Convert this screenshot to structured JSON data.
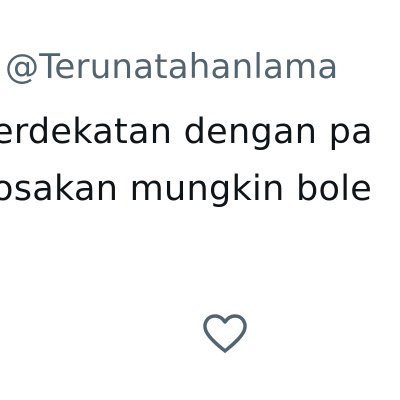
{
  "post": {
    "handle": "@Terunatahanlama",
    "body_lines": [
      "erdekatan dengan pa",
      "osakan mungkin bole"
    ]
  },
  "actions": {
    "like_icon": "heart-icon"
  },
  "colors": {
    "background": "#ffffff",
    "handle_text": "#536471",
    "body_text": "#0f1419",
    "icon": "#536471"
  }
}
